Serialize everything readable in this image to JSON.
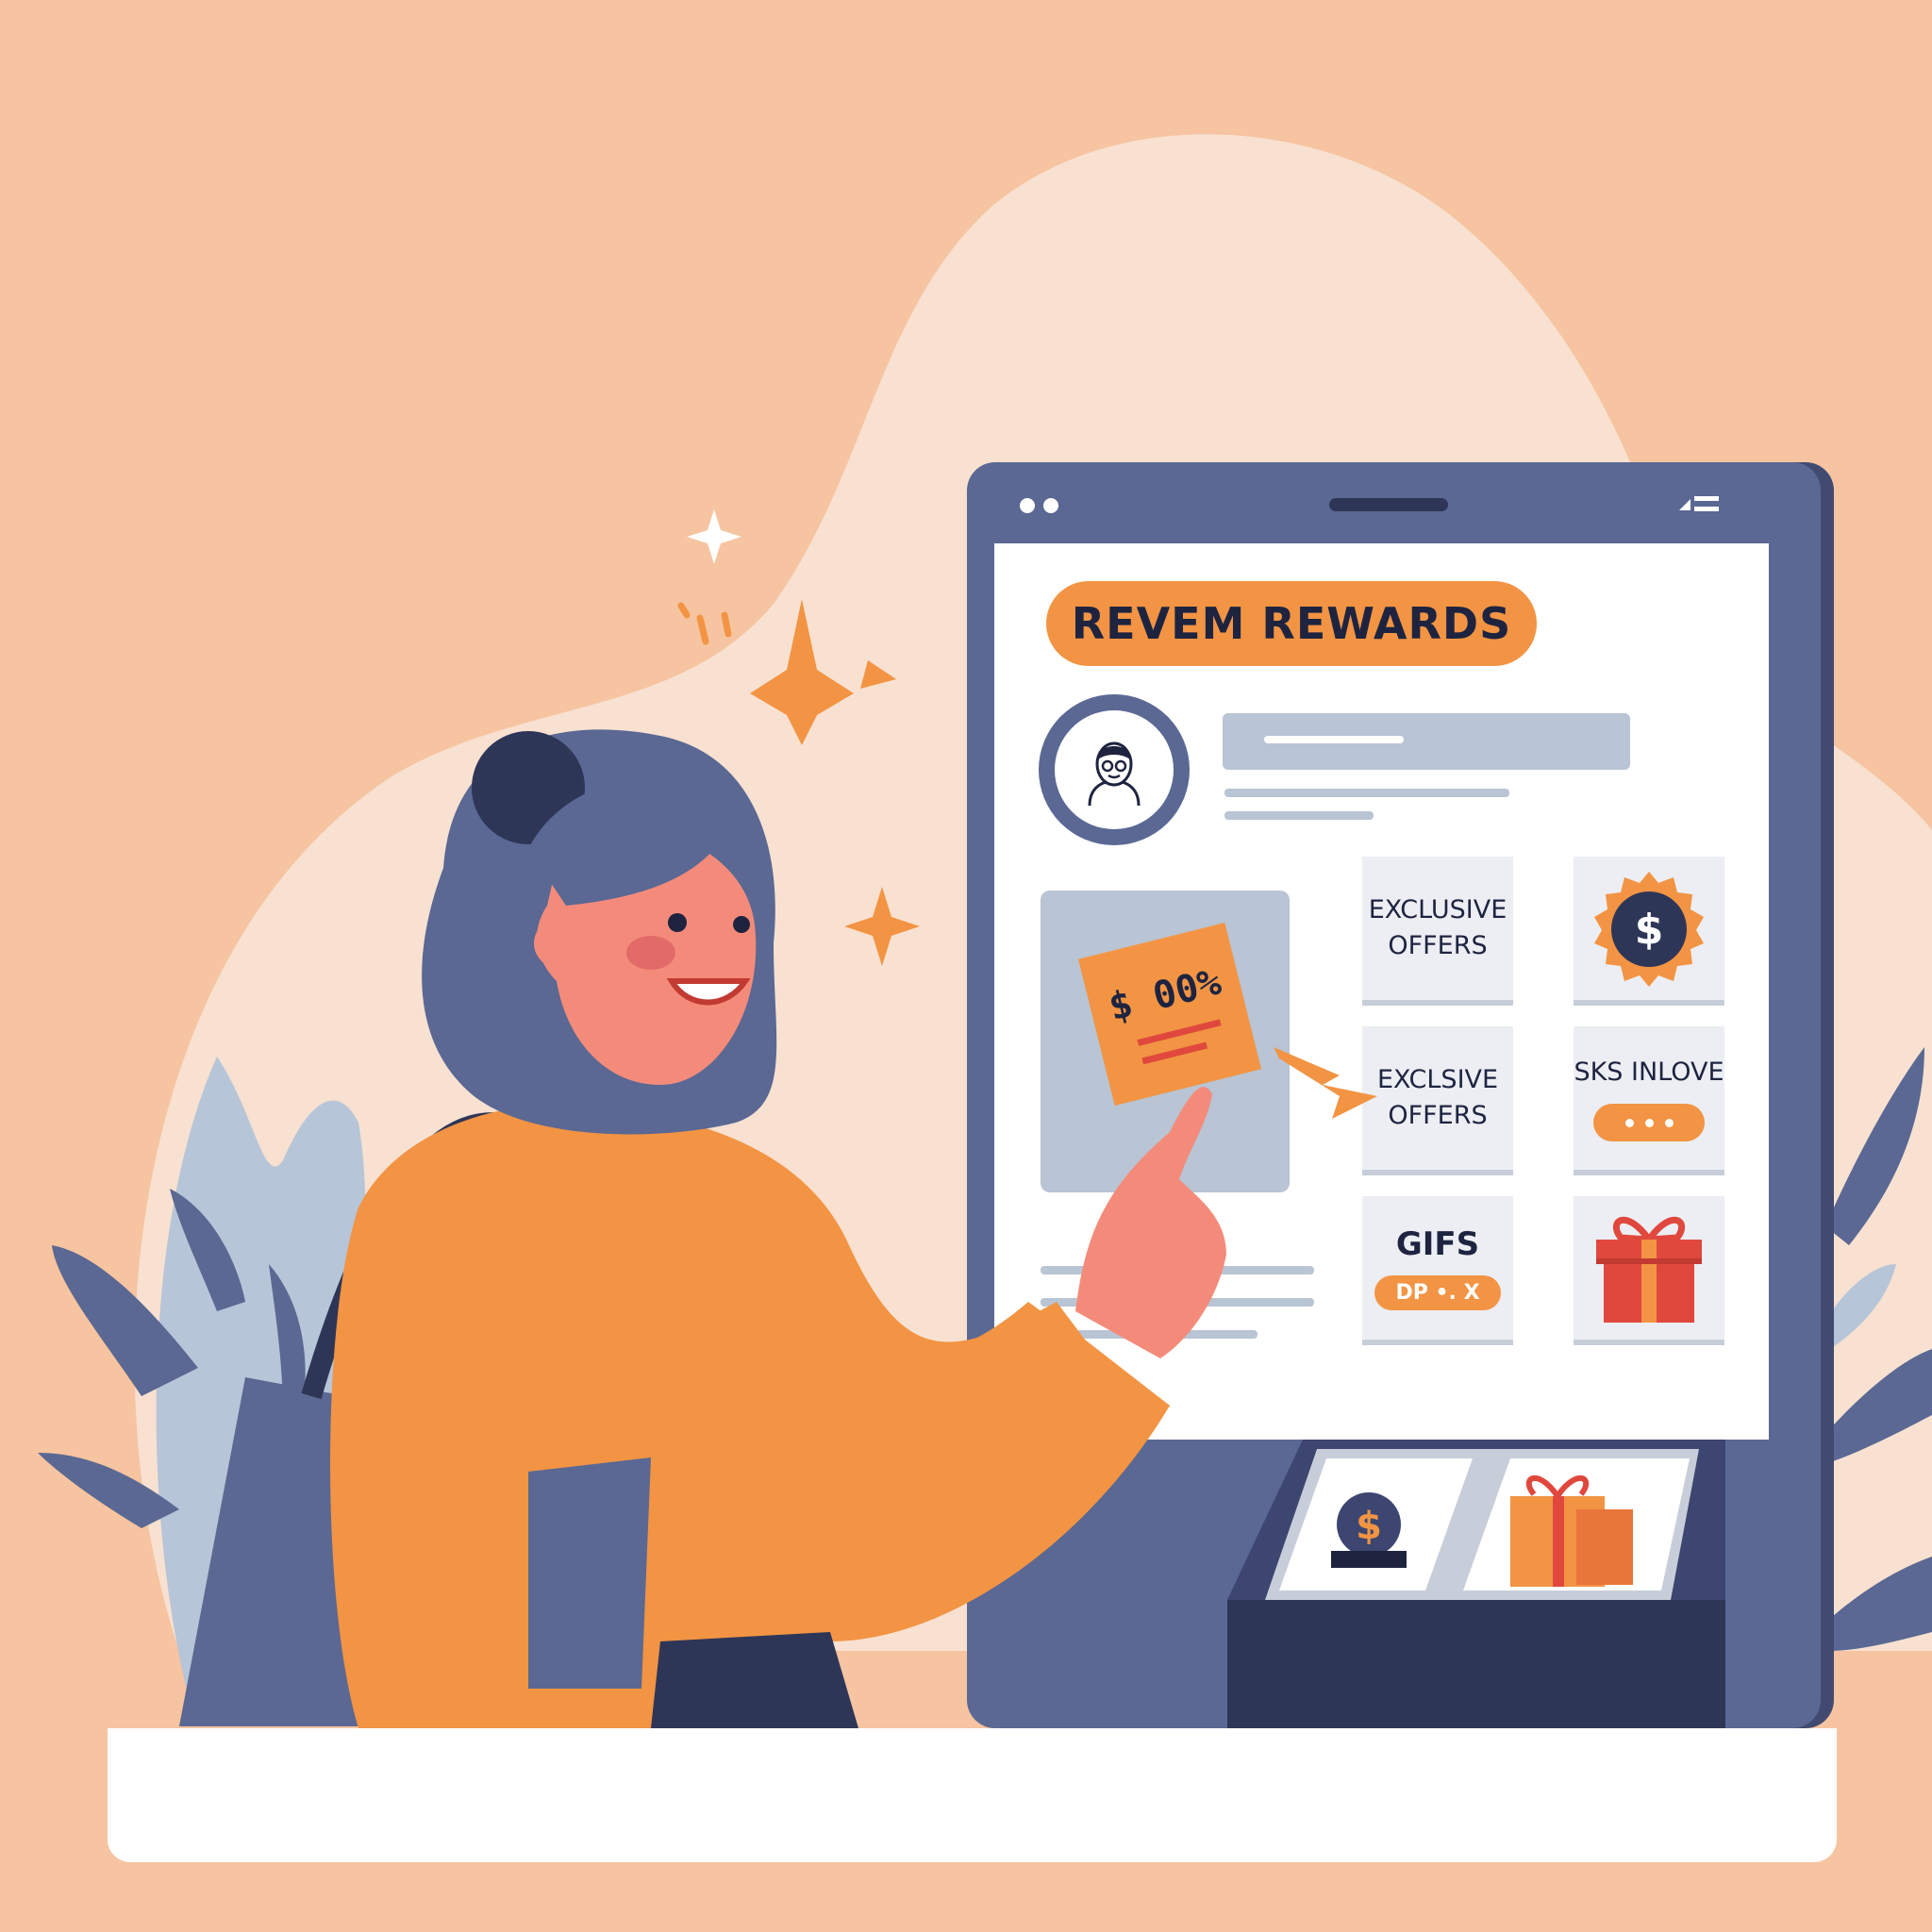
{
  "screen": {
    "title": "REVEM REWARDS",
    "coupon_text": "$ 00%",
    "tiles": [
      {
        "lines": [
          "EXCLUSIVE",
          "OFFERS"
        ]
      },
      {
        "icon": "dollar-badge-icon",
        "symbol": "$"
      },
      {
        "lines": [
          "EXCLSIVE",
          "OFFERS"
        ]
      },
      {
        "label": "SKS INLOVE",
        "button": "dots-button"
      },
      {
        "label": "GIFS",
        "button_label": "DP •. X"
      },
      {
        "icon": "gift-box-icon"
      }
    ],
    "tray_symbol": "$"
  },
  "colors": {
    "background": "#f6c4a0",
    "blob": "#f8e1d1",
    "accent_orange": "#f29443",
    "navy": "#5a6893",
    "dark_navy": "#2e3658",
    "gift_red": "#e0483d"
  }
}
